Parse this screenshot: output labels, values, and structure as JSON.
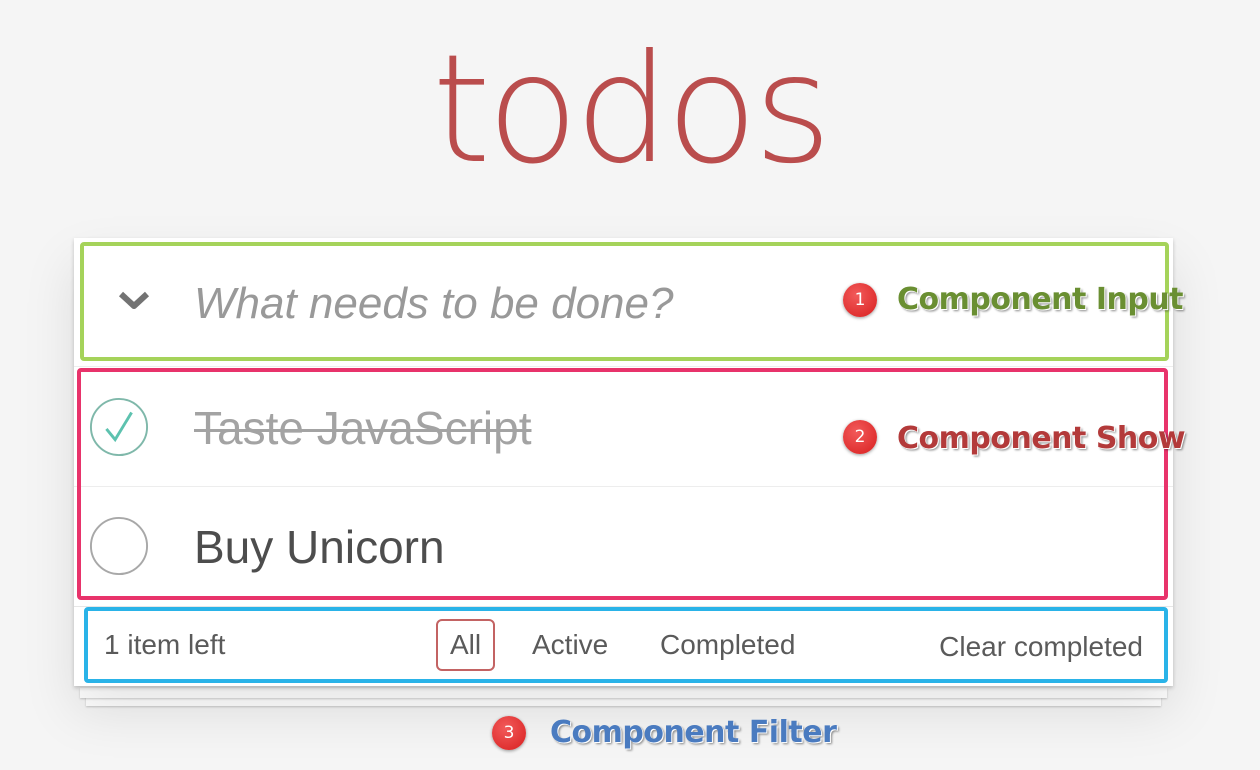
{
  "header": {
    "title": "todos"
  },
  "input": {
    "placeholder": "What needs to be done?",
    "value": ""
  },
  "todos": [
    {
      "label": "Taste JavaScript",
      "completed": true
    },
    {
      "label": "Buy Unicorn",
      "completed": false
    }
  ],
  "footer": {
    "count_text": "1 item left",
    "filters": [
      "All",
      "Active",
      "Completed"
    ],
    "selected_filter": "All",
    "clear_label": "Clear completed"
  },
  "annotations": [
    {
      "number": "1",
      "label": "Component Input"
    },
    {
      "number": "2",
      "label": "Component Show"
    },
    {
      "number": "3",
      "label": "Component Filter"
    }
  ],
  "colors": {
    "title": "#af2f2f",
    "check": "#5dc2af",
    "annotation_input_border": "#a5d35a",
    "annotation_show_border": "#e8336b",
    "annotation_filter_border": "#2ab3e8",
    "badge": "#e02424"
  },
  "icons": {
    "toggle_all": "chevron-down-icon",
    "completed_toggle": "checkmark-circle-icon",
    "active_toggle": "empty-circle-icon"
  }
}
